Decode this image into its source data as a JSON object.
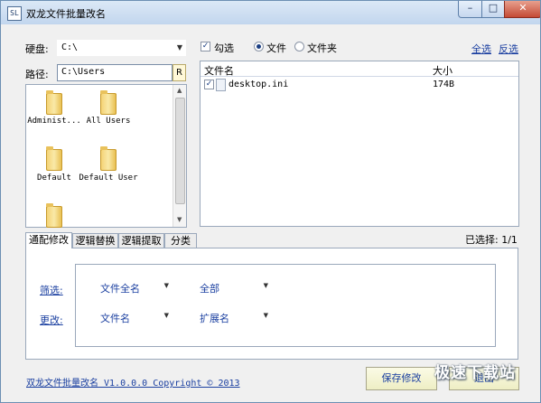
{
  "window": {
    "title": "双龙文件批量改名",
    "icon_text": "SL",
    "controls": {
      "minimize": "–",
      "maximize": "□",
      "close": "✕"
    }
  },
  "drive": {
    "label": "硬盘:",
    "value": "C:\\"
  },
  "path": {
    "label": "路径:",
    "value": "C:\\Users",
    "button": "R"
  },
  "folders": [
    {
      "name": "Administ...",
      "icon": "folder-icon"
    },
    {
      "name": "All Users",
      "icon": "folder-icon"
    },
    {
      "name": "Default",
      "icon": "folder-icon"
    },
    {
      "name": "Default User",
      "icon": "folder-icon"
    },
    {
      "name": "",
      "icon": "folder-icon"
    }
  ],
  "filter": {
    "check_label": "勾选",
    "check_mark": "✓",
    "file_label": "文件",
    "folder_label": "文件夹",
    "select_all": "全选",
    "invert": "反选"
  },
  "file_list": {
    "columns": [
      "文件名",
      "大小"
    ],
    "rows": [
      {
        "checked": "✓",
        "name": "desktop.ini",
        "size": "174B"
      }
    ]
  },
  "selection_status": "已选择: 1/1",
  "tabs": [
    {
      "label": "通配修改",
      "active": true
    },
    {
      "label": "逻辑替换",
      "active": false
    },
    {
      "label": "逻辑提取",
      "active": false
    },
    {
      "label": "分类",
      "active": false
    }
  ],
  "rules": {
    "filter_label": "筛选:",
    "filter_field": "文件全名",
    "filter_value": "全部",
    "change_label": "更改:",
    "change_field": "文件名",
    "change_value": "扩展名"
  },
  "footer": {
    "text": "双龙文件批量改名  V1.0.0.0  Copyright ©  2013"
  },
  "buttons": {
    "save": "保存修改",
    "exit": "退出"
  },
  "watermark": "极速下载站",
  "colors": {
    "accent": "#1a3fa0",
    "window_border": "#6d8fb3",
    "close_button": "#c44a35"
  }
}
